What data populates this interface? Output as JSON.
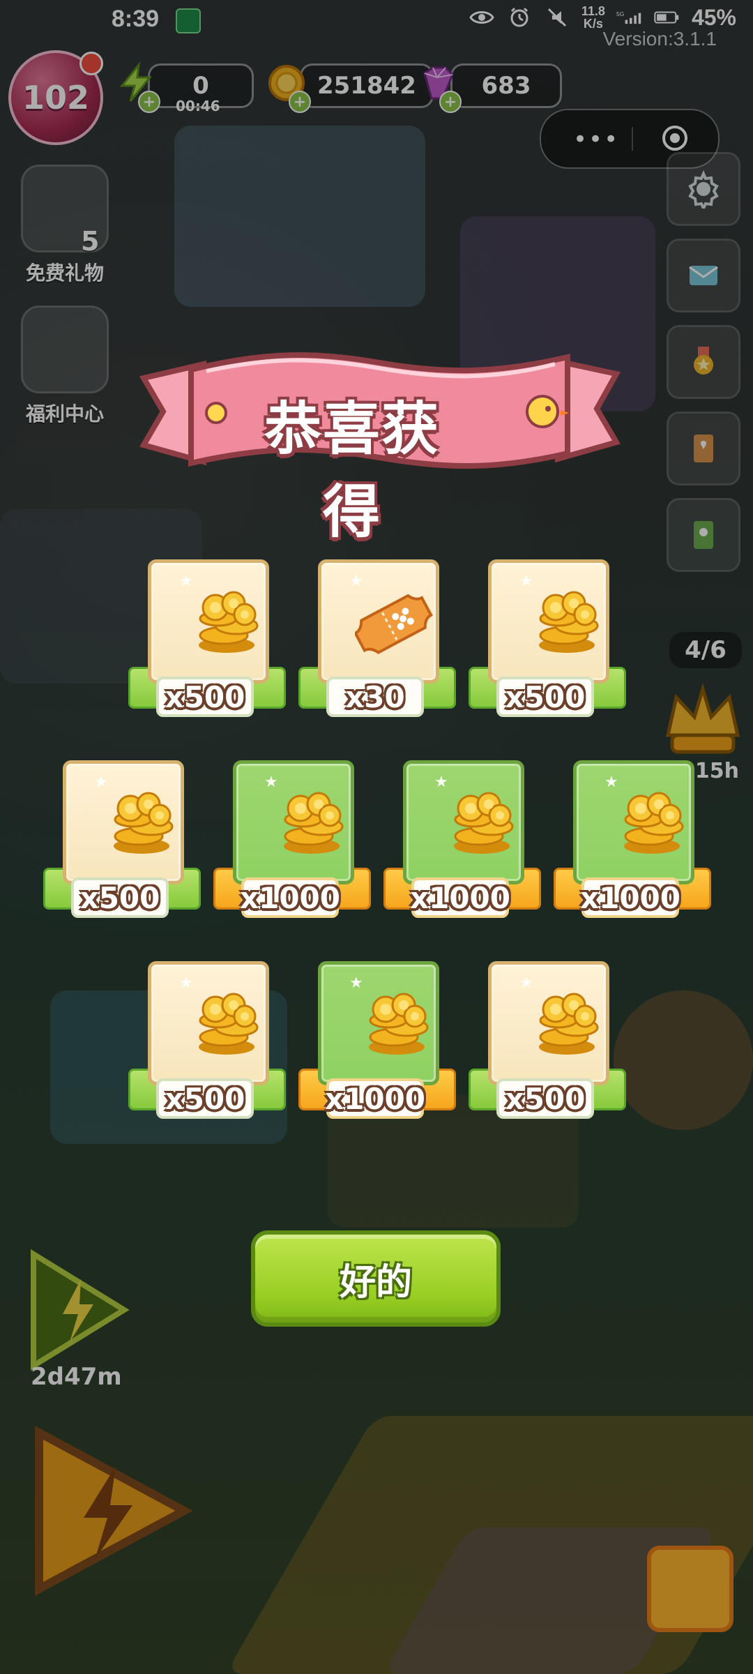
{
  "status_bar": {
    "time": "8:39",
    "network_speed_top": "11.8",
    "network_speed_bottom": "K/s",
    "signal_label": "5G",
    "battery": "45%"
  },
  "game_header": {
    "version": "Version:3.1.1",
    "level": "102",
    "energy": "0",
    "energy_timer": "00:46",
    "coins": "251842",
    "gems": "683"
  },
  "side_panel": {
    "left_badge_count": "5",
    "free_gift_label": "免费礼物",
    "welfare_center_label": "福利中心",
    "progress": "4/6",
    "side_timer": "15h",
    "bottom_timer": "2d47m"
  },
  "modal": {
    "title": "恭喜获得",
    "confirm_label": "好的"
  },
  "rewards": [
    {
      "amount": "x500",
      "icon": "gold-coins-icon",
      "style": "cream"
    },
    {
      "amount": "x30",
      "icon": "ticket-icon",
      "style": "cream"
    },
    {
      "amount": "x500",
      "icon": "gold-coins-icon",
      "style": "cream"
    },
    {
      "amount": "x500",
      "icon": "gold-coins-icon",
      "style": "cream"
    },
    {
      "amount": "x1000",
      "icon": "gold-coins-icon",
      "style": "green"
    },
    {
      "amount": "x1000",
      "icon": "gold-coins-icon",
      "style": "green"
    },
    {
      "amount": "x1000",
      "icon": "gold-coins-icon",
      "style": "green"
    },
    {
      "amount": "x500",
      "icon": "gold-coins-icon",
      "style": "cream"
    },
    {
      "amount": "x1000",
      "icon": "gold-coins-icon",
      "style": "green"
    },
    {
      "amount": "x500",
      "icon": "gold-coins-icon",
      "style": "cream"
    }
  ],
  "colors": {
    "ok_button": "#98cf23",
    "ribbon_pink": "#f0889b",
    "coin_gold": "#f2b31f"
  }
}
